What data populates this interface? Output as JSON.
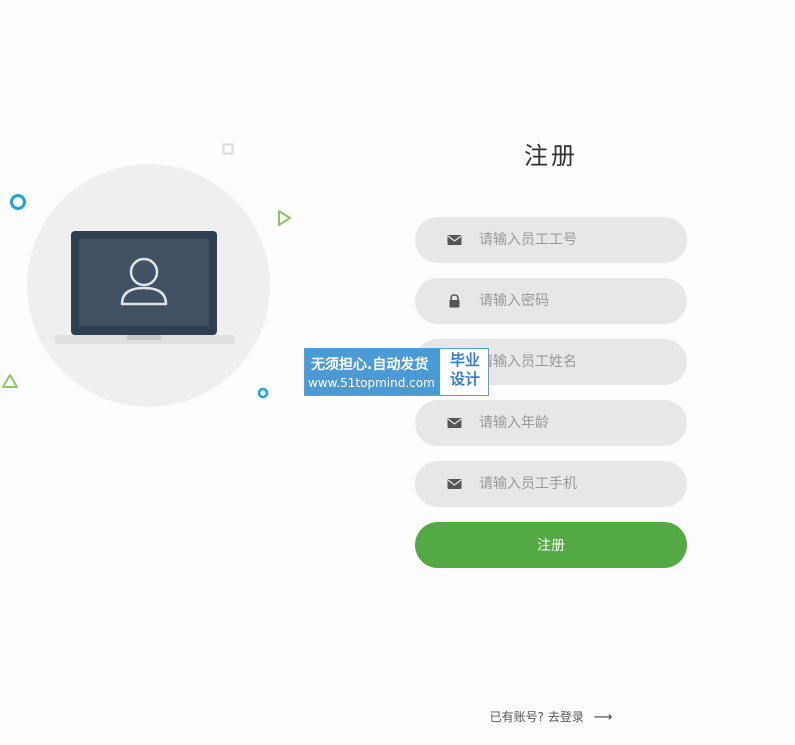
{
  "form": {
    "title": "注册",
    "fields": [
      {
        "icon": "envelope-icon",
        "placeholder": "请输入员工工号"
      },
      {
        "icon": "lock-icon",
        "placeholder": "请输入密码"
      },
      {
        "icon": "envelope-icon",
        "placeholder": "请输入员工姓名"
      },
      {
        "icon": "envelope-icon",
        "placeholder": "请输入年龄"
      },
      {
        "icon": "envelope-icon",
        "placeholder": "请输入员工手机"
      }
    ],
    "submit_label": "注册"
  },
  "footer": {
    "prompt": "已有账号?",
    "link_label": "去登录",
    "arrow": "⟶"
  },
  "watermark": {
    "line1": "无须担心.自动发货",
    "line2": "www.51topmind.com",
    "side_top": "毕业",
    "side_bottom": "设计"
  },
  "colors": {
    "accent_green": "#53a944",
    "field_bg": "#e7e7e7",
    "deco_blue": "#1aa3e0",
    "deco_green": "#8cc66a"
  }
}
